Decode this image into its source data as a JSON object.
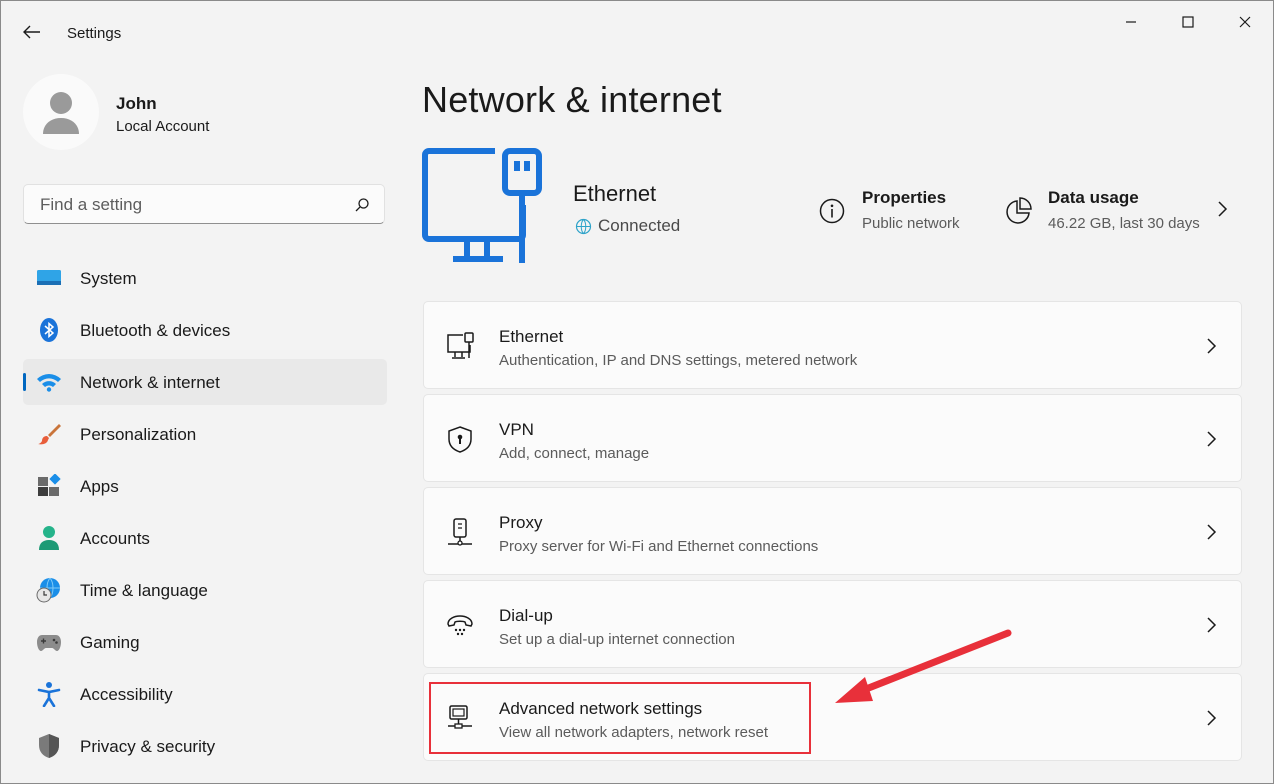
{
  "window": {
    "title": "Settings"
  },
  "profile": {
    "name": "John",
    "account_type": "Local Account"
  },
  "search": {
    "placeholder": "Find a setting",
    "value": ""
  },
  "sidebar": {
    "items": [
      {
        "label": "System",
        "icon": "system-icon",
        "active": false
      },
      {
        "label": "Bluetooth & devices",
        "icon": "bluetooth-icon",
        "active": false
      },
      {
        "label": "Network & internet",
        "icon": "wifi-icon",
        "active": true
      },
      {
        "label": "Personalization",
        "icon": "brush-icon",
        "active": false
      },
      {
        "label": "Apps",
        "icon": "apps-icon",
        "active": false
      },
      {
        "label": "Accounts",
        "icon": "person-icon",
        "active": false
      },
      {
        "label": "Time & language",
        "icon": "globe-clock-icon",
        "active": false
      },
      {
        "label": "Gaming",
        "icon": "gamepad-icon",
        "active": false
      },
      {
        "label": "Accessibility",
        "icon": "accessibility-icon",
        "active": false
      },
      {
        "label": "Privacy & security",
        "icon": "shield-icon",
        "active": false
      }
    ]
  },
  "main": {
    "page_title": "Network & internet",
    "hero": {
      "title": "Ethernet",
      "status": "Connected",
      "properties_title": "Properties",
      "properties_sub": "Public network",
      "usage_title": "Data usage",
      "usage_sub": "46.22 GB, last 30 days"
    },
    "cards": [
      {
        "title": "Ethernet",
        "subtitle": "Authentication, IP and DNS settings, metered network",
        "icon": "ethernet-icon"
      },
      {
        "title": "VPN",
        "subtitle": "Add, connect, manage",
        "icon": "vpn-shield-icon"
      },
      {
        "title": "Proxy",
        "subtitle": "Proxy server for Wi-Fi and Ethernet connections",
        "icon": "proxy-icon"
      },
      {
        "title": "Dial-up",
        "subtitle": "Set up a dial-up internet connection",
        "icon": "phone-icon"
      },
      {
        "title": "Advanced network settings",
        "subtitle": "View all network adapters, network reset",
        "icon": "network-computer-icon"
      }
    ]
  },
  "colors": {
    "accent": "#0067c0",
    "annotation": "#e8303a",
    "background": "#f3f3f3"
  }
}
